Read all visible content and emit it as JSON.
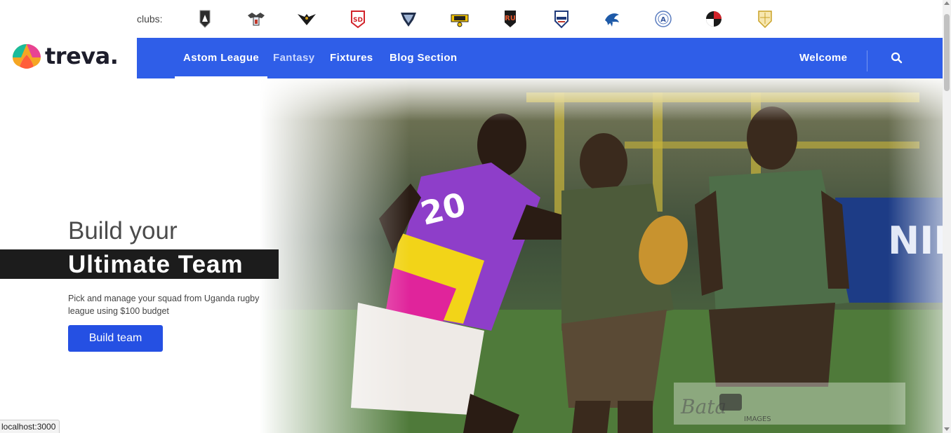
{
  "clubs": {
    "label": "clubs:",
    "items": [
      {
        "icon": "crest-dark-shield"
      },
      {
        "icon": "crest-eagle"
      },
      {
        "icon": "crest-black-bird"
      },
      {
        "icon": "crest-legion"
      },
      {
        "icon": "crest-navy-shield"
      },
      {
        "icon": "crest-yellow-banner"
      },
      {
        "icon": "crest-ru"
      },
      {
        "icon": "crest-old-blue"
      },
      {
        "icon": "crest-shark"
      },
      {
        "icon": "crest-circle-a"
      },
      {
        "icon": "crest-red-black"
      },
      {
        "icon": "crest-gold-shield"
      }
    ]
  },
  "logo": {
    "text": "treva."
  },
  "nav": {
    "items": [
      {
        "label": "Astom League",
        "active": true
      },
      {
        "label": "Fantasy",
        "active": false
      },
      {
        "label": "Fixtures",
        "active": false
      },
      {
        "label": "Blog Section",
        "active": false
      }
    ],
    "welcome": "Welcome",
    "search_icon": "search-icon"
  },
  "hero": {
    "line1": "Build your",
    "line2": "Ultimate Team",
    "description": "Pick and manage your squad from Uganda rugby league using $100 budget",
    "button": "Build team"
  },
  "status_bar": "localhost:3000",
  "colors": {
    "nav_bg": "#2f5ee8",
    "button_bg": "#2550e3",
    "band_bg": "#1c1c1c"
  }
}
